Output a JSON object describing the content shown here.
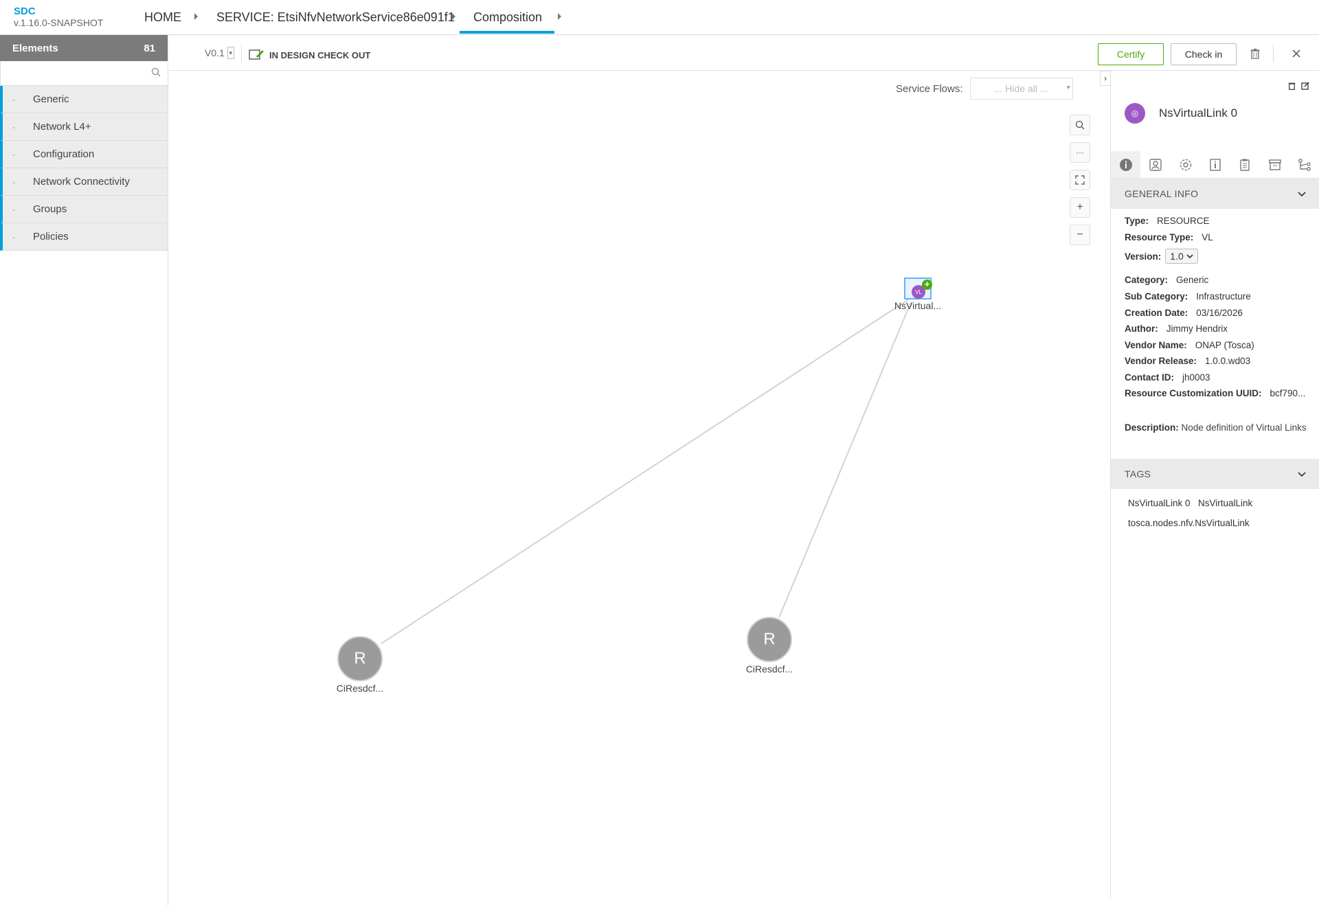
{
  "app": {
    "brand": "SDC",
    "version": "v.1.16.0-SNAPSHOT"
  },
  "breadcrumb": {
    "home": "HOME",
    "service": "SERVICE: EtsiNfvNetworkService86e091f1",
    "composition": "Composition"
  },
  "left_panel": {
    "header_label": "Elements",
    "count": "81",
    "search_placeholder": "",
    "categories": [
      "Generic",
      "Network L4+",
      "Configuration",
      "Network Connectivity",
      "Groups",
      "Policies"
    ]
  },
  "toolbar": {
    "version": "V0.1",
    "status": "IN DESIGN CHECK OUT",
    "certify_label": "Certify",
    "checkin_label": "Check in"
  },
  "canvas": {
    "service_flows_label": "Service Flows:",
    "service_flows_value": "... Hide all ...",
    "nodes": [
      {
        "label": "NsVirtual...",
        "icon_text": "VL"
      },
      {
        "label": "CiResdcf...",
        "icon_text": "R"
      },
      {
        "label": "CiResdcf...",
        "icon_text": "R"
      }
    ]
  },
  "right_panel": {
    "title": "NsVirtualLink 0",
    "general_info_label": "GENERAL INFO",
    "info": {
      "type_k": "Type:",
      "type_v": "RESOURCE",
      "rtype_k": "Resource Type:",
      "rtype_v": "VL",
      "version_k": "Version:",
      "version_v": "1.0",
      "category_k": "Category:",
      "category_v": "Generic",
      "subcat_k": "Sub Category:",
      "subcat_v": "Infrastructure",
      "date_k": "Creation Date:",
      "date_v": "03/16/2026",
      "author_k": "Author:",
      "author_v": "Jimmy Hendrix",
      "vendor_k": "Vendor Name:",
      "vendor_v": "ONAP (Tosca)",
      "vrel_k": "Vendor Release:",
      "vrel_v": "1.0.0.wd03",
      "contact_k": "Contact ID:",
      "contact_v": "jh0003",
      "uuid_k": "Resource Customization UUID:",
      "uuid_v": "bcf790..."
    },
    "description_k": "Description:",
    "description_v": "Node definition of Virtual Links",
    "tags_label": "TAGS",
    "tags": [
      "NsVirtualLink 0",
      "NsVirtualLink",
      "tosca.nodes.nfv.NsVirtualLink"
    ]
  },
  "icons": {
    "search": "search-icon",
    "trash": "trash-icon",
    "close": "close-icon",
    "zoom_in": "plus-icon",
    "zoom_out": "minus-icon",
    "fit": "fit-screen-icon",
    "more": "more-icon"
  },
  "colors": {
    "accent": "#009fdb",
    "certify": "#4ca90c",
    "vl_purple": "#9b59c6"
  }
}
